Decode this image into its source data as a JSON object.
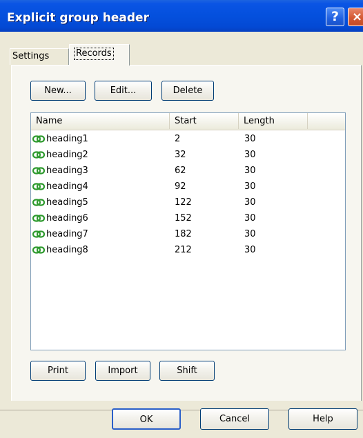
{
  "window": {
    "title": "Explicit group header",
    "help_glyph": "?",
    "close_glyph": "×"
  },
  "tabs": [
    {
      "label": "Settings"
    },
    {
      "label": "Records"
    }
  ],
  "record_buttons": {
    "new": "New...",
    "edit": "Edit...",
    "delete": "Delete"
  },
  "list": {
    "columns": [
      "Name",
      "Start",
      "Length"
    ],
    "rows": [
      {
        "name": "heading1",
        "start": "2",
        "length": "30"
      },
      {
        "name": "heading2",
        "start": "32",
        "length": "30"
      },
      {
        "name": "heading3",
        "start": "62",
        "length": "30"
      },
      {
        "name": "heading4",
        "start": "92",
        "length": "30"
      },
      {
        "name": "heading5",
        "start": "122",
        "length": "30"
      },
      {
        "name": "heading6",
        "start": "152",
        "length": "30"
      },
      {
        "name": "heading7",
        "start": "182",
        "length": "30"
      },
      {
        "name": "heading8",
        "start": "212",
        "length": "30"
      }
    ]
  },
  "bottom_buttons": {
    "print": "Print",
    "import": "Import",
    "shift": "Shift"
  },
  "dialog_buttons": {
    "ok": "OK",
    "cancel": "Cancel",
    "help": "Help"
  },
  "icons": {
    "row_icon": "link-icon"
  },
  "colors": {
    "titlebar": "#0450dd",
    "icon_green": "#2e9a2e"
  }
}
